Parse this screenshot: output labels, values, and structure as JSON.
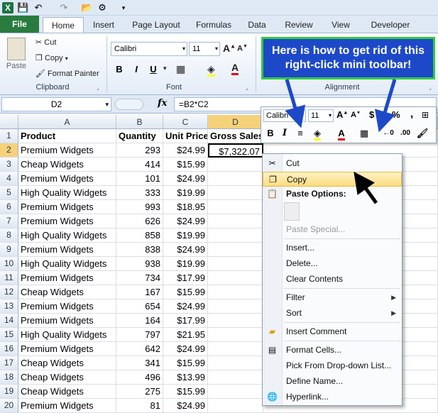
{
  "ribbon_tabs": [
    "File",
    "Home",
    "Insert",
    "Page Layout",
    "Formulas",
    "Data",
    "Review",
    "View",
    "Developer"
  ],
  "clipboard": {
    "paste": "Paste",
    "cut": "Cut",
    "copy": "Copy",
    "format_painter": "Format Painter",
    "label": "Clipboard"
  },
  "font_group": {
    "font_name": "Calibri",
    "font_size": "11",
    "bold": "B",
    "italic": "I",
    "underline": "U",
    "label": "Font"
  },
  "alignment_label": "Alignment",
  "callout": "Here is how to get rid of this right-click mini toolbar!",
  "formula_bar": {
    "name_box": "D2",
    "fx": "fx",
    "formula": "=B2*C2"
  },
  "columns": [
    "A",
    "B",
    "C",
    "D"
  ],
  "header_row": {
    "row": "1",
    "a": "Product",
    "b": "Quantity",
    "c": "Unit Price",
    "d": "Gross Sales"
  },
  "rows": [
    {
      "row": "2",
      "a": "Premium Widgets",
      "b": "293",
      "c": "$24.99",
      "d": "$7,322.07"
    },
    {
      "row": "3",
      "a": "Cheap Widgets",
      "b": "414",
      "c": "$15.99",
      "d": ""
    },
    {
      "row": "4",
      "a": "Premium Widgets",
      "b": "101",
      "c": "$24.99",
      "d": ""
    },
    {
      "row": "5",
      "a": "High Quality Widgets",
      "b": "333",
      "c": "$19.99",
      "d": ""
    },
    {
      "row": "6",
      "a": "Premium Widgets",
      "b": "993",
      "c": "$18.95",
      "d": ""
    },
    {
      "row": "7",
      "a": "Premium Widgets",
      "b": "626",
      "c": "$24.99",
      "d": ""
    },
    {
      "row": "8",
      "a": "High Quality Widgets",
      "b": "858",
      "c": "$19.99",
      "d": ""
    },
    {
      "row": "9",
      "a": "Premium Widgets",
      "b": "838",
      "c": "$24.99",
      "d": ""
    },
    {
      "row": "10",
      "a": "High Quality Widgets",
      "b": "938",
      "c": "$19.99",
      "d": ""
    },
    {
      "row": "11",
      "a": "Premium Widgets",
      "b": "734",
      "c": "$17.99",
      "d": ""
    },
    {
      "row": "12",
      "a": "Cheap Widgets",
      "b": "167",
      "c": "$15.99",
      "d": ""
    },
    {
      "row": "13",
      "a": "Premium Widgets",
      "b": "654",
      "c": "$24.99",
      "d": ""
    },
    {
      "row": "14",
      "a": "Premium Widgets",
      "b": "164",
      "c": "$17.99",
      "d": ""
    },
    {
      "row": "15",
      "a": "High Quality Widgets",
      "b": "797",
      "c": "$21.95",
      "d": ""
    },
    {
      "row": "16",
      "a": "Premium Widgets",
      "b": "642",
      "c": "$24.99",
      "d": ""
    },
    {
      "row": "17",
      "a": "Cheap Widgets",
      "b": "341",
      "c": "$15.99",
      "d": ""
    },
    {
      "row": "18",
      "a": "Cheap Widgets",
      "b": "496",
      "c": "$13.99",
      "d": ""
    },
    {
      "row": "19",
      "a": "Cheap Widgets",
      "b": "275",
      "c": "$15.99",
      "d": ""
    },
    {
      "row": "20",
      "a": "Premium Widgets",
      "b": "81",
      "c": "$24.99",
      "d": ""
    }
  ],
  "mini_toolbar": {
    "font_name": "Calibri",
    "font_size": "11",
    "currency": "$",
    "percent": "%",
    "comma": ","
  },
  "context_menu": {
    "cut": "Cut",
    "copy": "Copy",
    "paste_options": "Paste Options:",
    "paste_special": "Paste Special...",
    "insert": "Insert...",
    "delete": "Delete...",
    "clear_contents": "Clear Contents",
    "filter": "Filter",
    "sort": "Sort",
    "insert_comment": "Insert Comment",
    "format_cells": "Format Cells...",
    "pick_from_list": "Pick From Drop-down List...",
    "define_name": "Define Name...",
    "hyperlink": "Hyperlink..."
  },
  "colors": {
    "file_tab": "#2a7b3f",
    "callout_bg": "#1d49c9",
    "callout_border": "#2ecc40",
    "menu_highlight": "#fbdc80"
  }
}
